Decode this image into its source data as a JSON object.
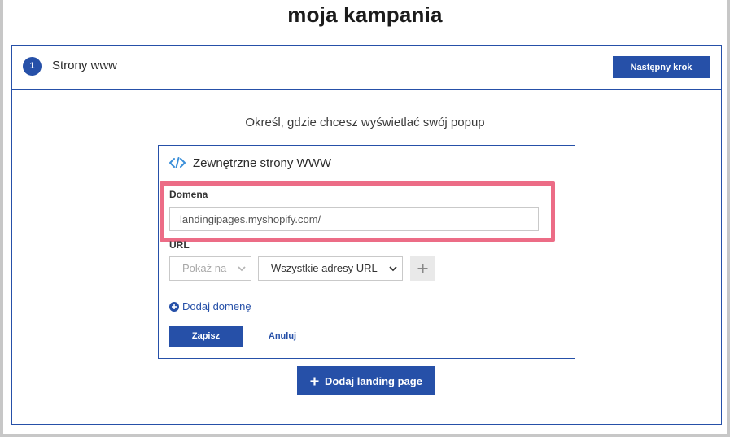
{
  "page": {
    "title": "moja kampania"
  },
  "step": {
    "number": "1",
    "title": "Strony www",
    "next_label": "Następny krok"
  },
  "main": {
    "instruction": "Określ, gdzie chcesz wyświetlać swój popup"
  },
  "panel": {
    "title": "Zewnętrzne strony WWW",
    "icon": "code-icon",
    "domain_label": "Domena",
    "domain_value": "landingipages.myshopify.com/",
    "url_label": "URL",
    "show_select": "Pokaż na",
    "url_select": "Wszystkie adresy URL",
    "add_domain_label": "Dodaj domenę",
    "save_label": "Zapisz",
    "cancel_label": "Anuluj"
  },
  "actions": {
    "add_landing_label": "Dodaj landing page"
  },
  "colors": {
    "primary": "#2650a8",
    "highlight": "#ec6c86",
    "icon_blue": "#3b8fd9"
  }
}
